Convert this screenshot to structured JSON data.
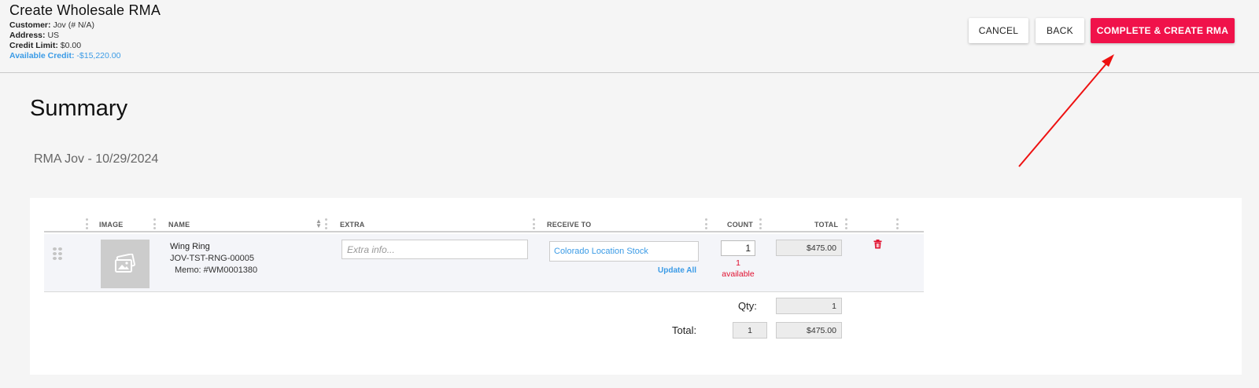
{
  "header": {
    "title": "Create Wholesale RMA",
    "customer_label": "Customer:",
    "customer_value": "Jov (# N/A)",
    "address_label": "Address:",
    "address_value": "US",
    "credit_limit_label": "Credit Limit:",
    "credit_limit_value": "$0.00",
    "available_credit_label": "Available Credit:",
    "available_credit_value": "-$15,220.00"
  },
  "actions": {
    "cancel_label": "CANCEL",
    "back_label": "BACK",
    "complete_label": "COMPLETE & CREATE RMA",
    "complete_color": "#f0124a"
  },
  "summary": {
    "title": "Summary",
    "rma_name": "RMA Jov - 10/29/2024"
  },
  "table": {
    "columns": {
      "image": "IMAGE",
      "name": "NAME",
      "extra": "EXTRA",
      "receive_to": "RECEIVE TO",
      "count": "COUNT",
      "total": "TOTAL"
    },
    "rows": [
      {
        "name": "Wing Ring",
        "sku": "JOV-TST-RNG-00005",
        "memo": "Memo: #WM0001380",
        "extra_placeholder": "Extra info...",
        "extra_value": "",
        "receive_to": "Colorado Location Stock",
        "update_all": "Update All",
        "count": "1",
        "available_count": "1",
        "available_label": "available",
        "total": "$475.00",
        "image_icon": "image-placeholder-icon",
        "delete_icon": "trash-icon"
      }
    ]
  },
  "totals": {
    "qty_label": "Qty:",
    "qty_value": "1",
    "total_label": "Total:",
    "total_count": "1",
    "total_amount": "$475.00"
  },
  "colors": {
    "link": "#3b9be6",
    "danger": "#e0102f",
    "annotation_arrow": "#ee1111"
  }
}
